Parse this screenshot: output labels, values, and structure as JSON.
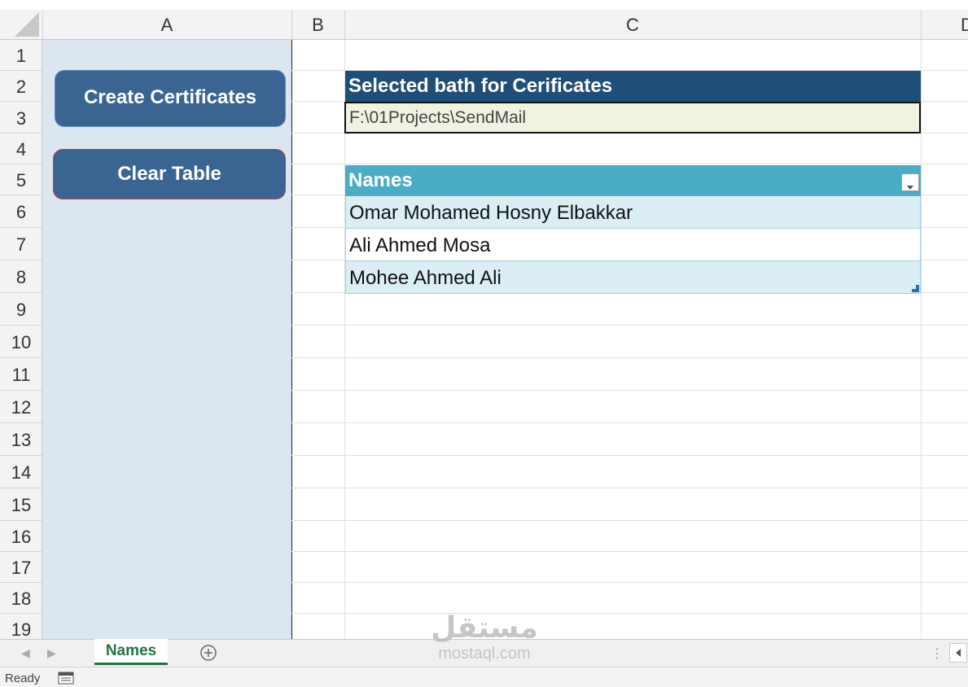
{
  "columns": [
    "A",
    "B",
    "C",
    "D"
  ],
  "rows": [
    "1",
    "2",
    "3",
    "4",
    "5",
    "6",
    "7",
    "8",
    "9",
    "10",
    "11",
    "12",
    "13",
    "14",
    "15",
    "16",
    "17",
    "18",
    "19"
  ],
  "buttons": {
    "create": "Create Certificates",
    "clear": "Clear Table"
  },
  "path": {
    "header": "Selected bath for Cerificates",
    "value": "F:\\01Projects\\SendMail"
  },
  "table": {
    "header": "Names",
    "rows": [
      "Omar Mohamed Hosny Elbakkar",
      "Ali Ahmed Mosa",
      "Mohee Ahmed Ali"
    ]
  },
  "sheet_tabs": {
    "active": "Names"
  },
  "status": {
    "text": "Ready"
  },
  "watermark": {
    "arabic": "مستقل",
    "latin": "mostaql.com"
  },
  "colors": {
    "panel": "#dce6f0",
    "button": "#3a6593",
    "path_header": "#1f4e79",
    "table_header": "#4bacc6",
    "band": "#dbeef4",
    "tab_accent": "#217346"
  },
  "icons": [
    "filter-dropdown-icon",
    "add-sheet-icon",
    "macro-record-icon",
    "select-all-icon"
  ]
}
